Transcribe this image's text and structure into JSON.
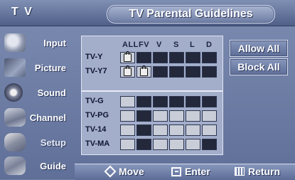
{
  "header": {
    "section": "T V",
    "title": "TV Parental Guidelines"
  },
  "sidebar": {
    "items": [
      {
        "label": "Input",
        "icon": "input-icon"
      },
      {
        "label": "Picture",
        "icon": "picture-icon"
      },
      {
        "label": "Sound",
        "icon": "sound-icon"
      },
      {
        "label": "Channel",
        "icon": "channel-icon"
      },
      {
        "label": "Setup",
        "icon": "setup-icon"
      },
      {
        "label": "Guide",
        "icon": "guide-icon"
      }
    ]
  },
  "grid": {
    "columns": [
      "ALL",
      "FV",
      "V",
      "S",
      "L",
      "D"
    ],
    "rows": [
      {
        "label": "TV-Y",
        "cells": [
          "lock",
          "blk",
          "blk",
          "blk",
          "blk",
          "blk"
        ]
      },
      {
        "label": "TV-Y7",
        "cells": [
          "lock",
          "lock",
          "blk",
          "blk",
          "blk",
          "blk"
        ]
      },
      {
        "label": "TV-G",
        "cells": [
          "lt",
          "blk",
          "blk",
          "blk",
          "blk",
          "blk"
        ]
      },
      {
        "label": "TV-PG",
        "cells": [
          "lt",
          "blk",
          "lt",
          "lt",
          "lt",
          "lt"
        ]
      },
      {
        "label": "TV-14",
        "cells": [
          "lt",
          "blk",
          "lt",
          "lt",
          "lt",
          "lt"
        ]
      },
      {
        "label": "TV-MA",
        "cells": [
          "lt",
          "blk",
          "lt",
          "lt",
          "lt",
          "blk"
        ]
      }
    ]
  },
  "buttons": {
    "allow_all": "Allow All",
    "block_all": "Block All"
  },
  "footer": {
    "move": "Move",
    "enter": "Enter",
    "return": "Return"
  },
  "colors": {
    "background": "#6f80a8",
    "dark_cell": "#23283a",
    "light_cell": "#c8cdd8"
  }
}
